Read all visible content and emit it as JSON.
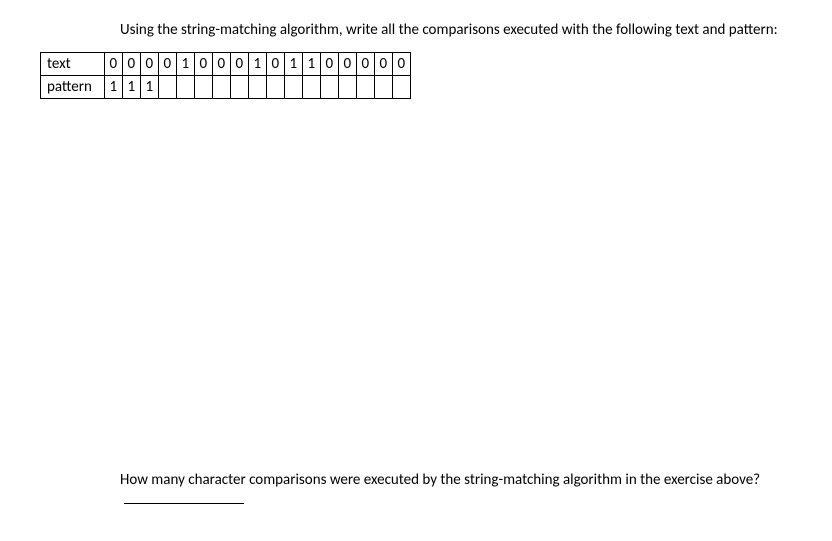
{
  "intro": "Using the string-matching algorithm, write all the comparisons executed with the following text and pattern:",
  "labels": {
    "text": "text",
    "pattern": "pattern"
  },
  "chart_data": {
    "type": "table",
    "columns": 17,
    "text_row": [
      "0",
      "0",
      "0",
      "0",
      "1",
      "0",
      "0",
      "0",
      "1",
      "0",
      "1",
      "1",
      "0",
      "0",
      "0",
      "0",
      "0"
    ],
    "pattern_row": [
      "1",
      "1",
      "1",
      "",
      "",
      "",
      "",
      "",
      "",
      "",
      "",
      "",
      "",
      "",
      "",
      "",
      ""
    ]
  },
  "question2_part1": "How many character comparisons were executed by the string-matching algorithm in the exercise above?",
  "blank_value": ""
}
